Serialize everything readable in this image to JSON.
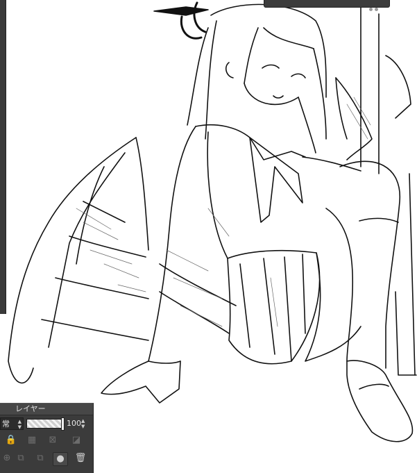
{
  "layer_panel": {
    "title": "レイヤー",
    "blend_mode": "常",
    "opacity": "100",
    "icons": {
      "lock": "lock-icon",
      "lock_transparency": "checker-lock-icon",
      "clip": "clip-icon",
      "reference": "reference-icon",
      "new_raster": "new-layer-icon",
      "new_vector": "new-vector-layer-icon",
      "merge": "merge-down-icon",
      "mask": "mask-icon",
      "delete": "trash-icon"
    }
  },
  "colors": {
    "panel_bg": "#3b3b3b",
    "canvas_bg": "#ffffff",
    "line_art": "#111111"
  }
}
